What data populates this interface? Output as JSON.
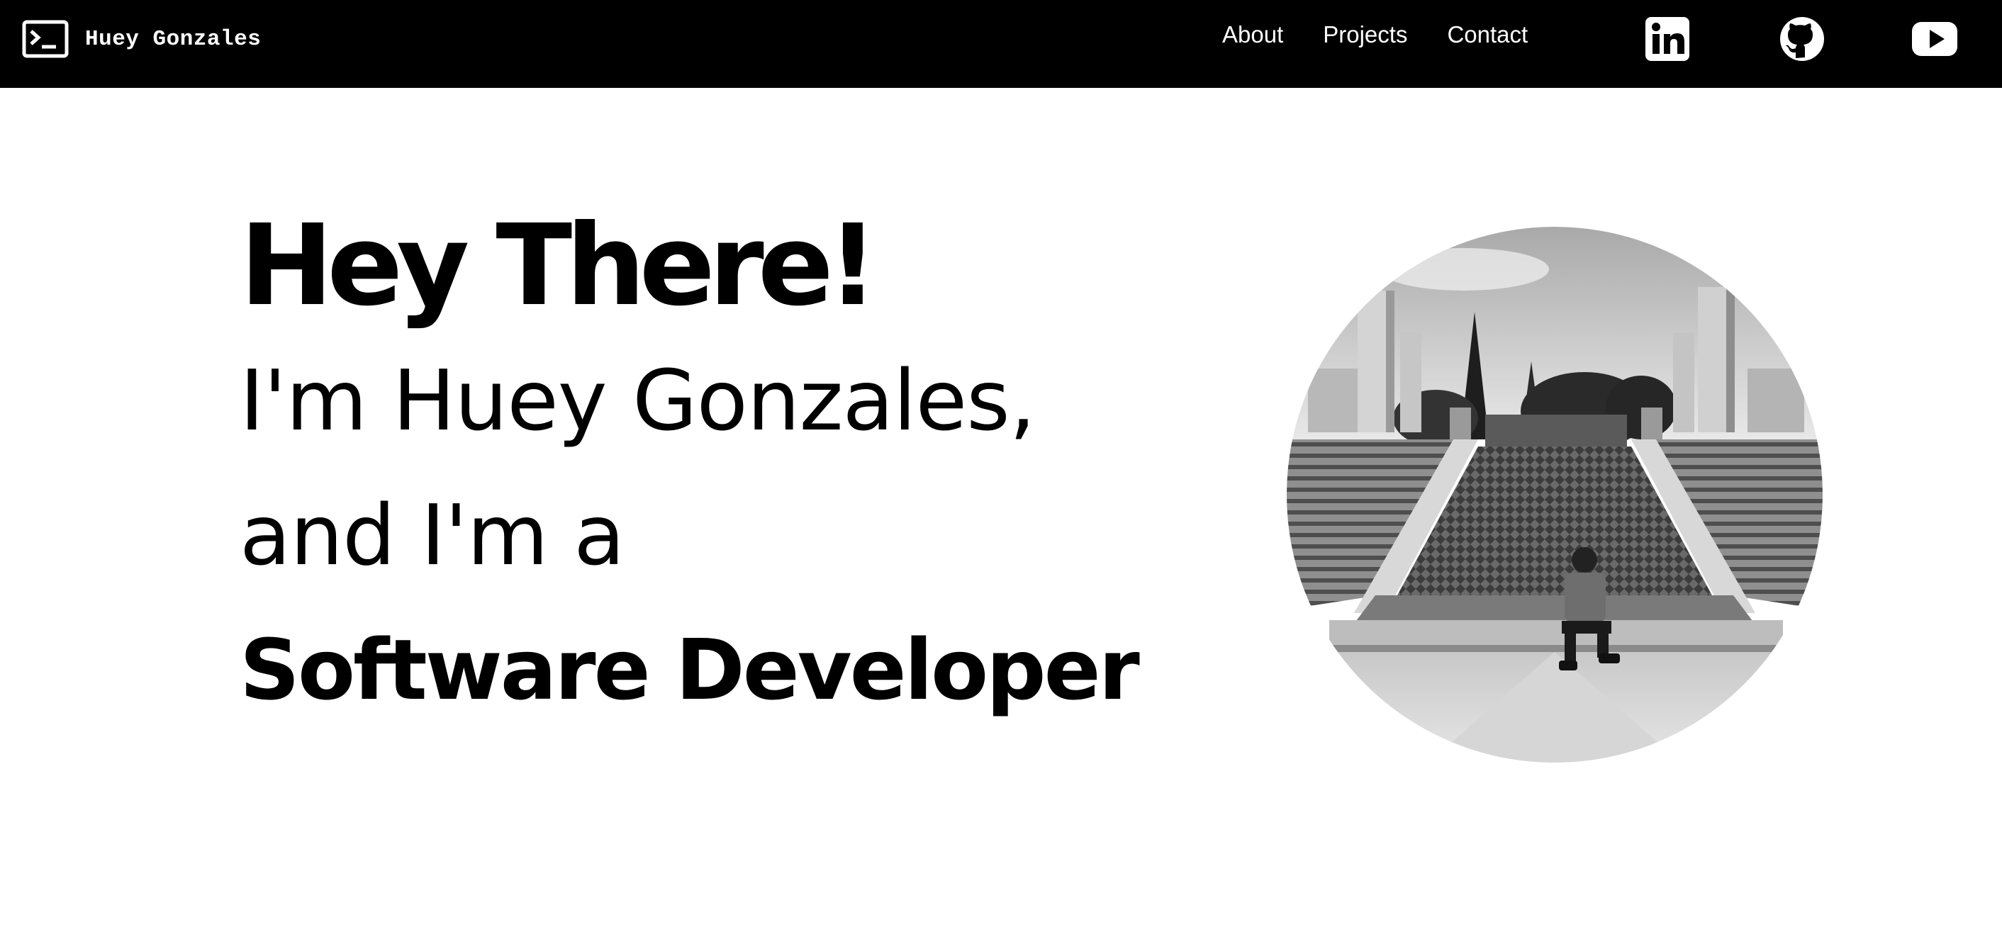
{
  "header": {
    "brand_name": "Huey Gonzales",
    "brand_icon": "terminal-icon",
    "nav": [
      {
        "label": "About"
      },
      {
        "label": "Projects"
      },
      {
        "label": "Contact"
      }
    ],
    "social": [
      {
        "icon": "linkedin-icon"
      },
      {
        "icon": "github-icon"
      },
      {
        "icon": "youtube-icon"
      }
    ]
  },
  "hero": {
    "greeting": "Hey There!",
    "line1": "I'm Huey Gonzales,",
    "line2": "and I'm a",
    "role": "Software Developer"
  },
  "photo": {
    "description_icon": "profile-photo"
  },
  "colors": {
    "nav_background": "#000000",
    "page_background": "#ffffff",
    "text": "#000000",
    "nav_text": "#ffffff"
  }
}
